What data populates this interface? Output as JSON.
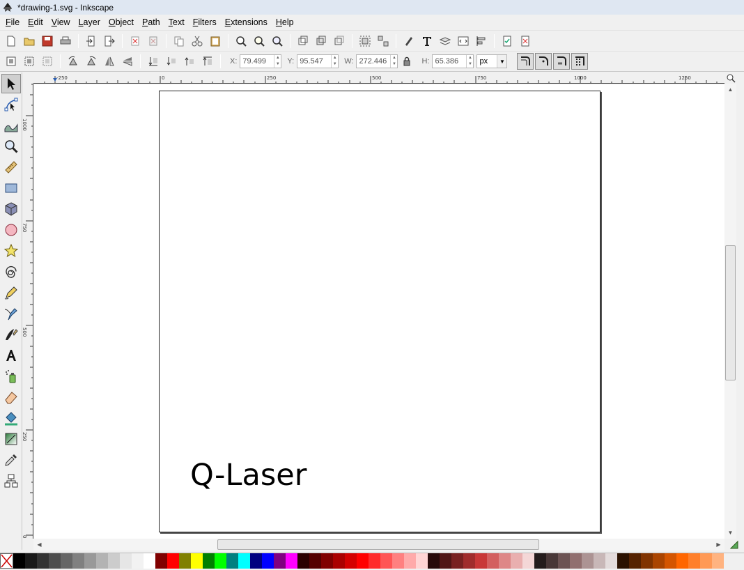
{
  "window": {
    "title": "*drawing-1.svg - Inkscape"
  },
  "menus": [
    "File",
    "Edit",
    "View",
    "Layer",
    "Object",
    "Path",
    "Text",
    "Filters",
    "Extensions",
    "Help"
  ],
  "controls": {
    "x_label": "X:",
    "x_value": "79.499",
    "y_label": "Y:",
    "y_value": "95.547",
    "w_label": "W:",
    "w_value": "272.446",
    "h_label": "H:",
    "h_value": "65.386",
    "unit": "px"
  },
  "rulers": {
    "horizontal": [
      "-250",
      "0",
      "250",
      "500",
      "750",
      "1000",
      "1250"
    ],
    "vertical": [
      "1000",
      "750",
      "500",
      "250",
      "0"
    ]
  },
  "canvas": {
    "text": "Q-Laser"
  },
  "palette": [
    "#000000",
    "#1a1a1a",
    "#333333",
    "#4d4d4d",
    "#666666",
    "#808080",
    "#999999",
    "#b3b3b3",
    "#cccccc",
    "#e6e6e6",
    "#f2f2f2",
    "#ffffff",
    "#800000",
    "#ff0000",
    "#808000",
    "#ffff00",
    "#008000",
    "#00ff00",
    "#008080",
    "#00ffff",
    "#000080",
    "#0000ff",
    "#800080",
    "#ff00ff",
    "#2b0000",
    "#550000",
    "#800000",
    "#aa0000",
    "#d40000",
    "#ff0000",
    "#ff2a2a",
    "#ff5555",
    "#ff8080",
    "#ffaaaa",
    "#ffd5d5",
    "#280b0b",
    "#501616",
    "#782121",
    "#a02c2c",
    "#c83737",
    "#d35f5f",
    "#de8787",
    "#e9afaf",
    "#f4d7d7",
    "#241c1c",
    "#483737",
    "#6c5353",
    "#916f6f",
    "#ac9393",
    "#c8b7b7",
    "#e3dbdb",
    "#2b1100",
    "#552200",
    "#803300",
    "#aa4400",
    "#d45500",
    "#ff6600",
    "#ff7f2a",
    "#ff9955",
    "#ffb380"
  ]
}
